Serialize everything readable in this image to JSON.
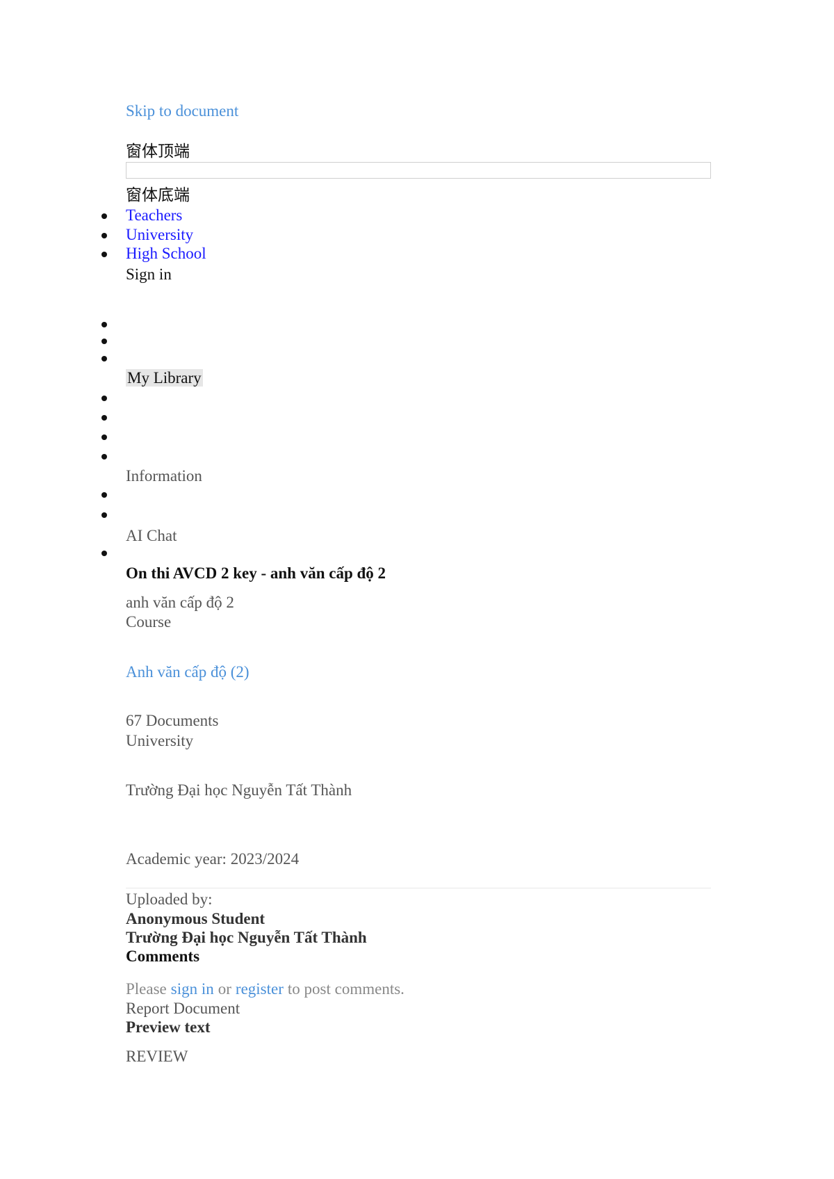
{
  "skip_link": "Skip to document",
  "form_top_label": "窗体顶端",
  "form_bottom_label": "窗体底端",
  "search": {
    "value": "",
    "placeholder": ""
  },
  "nav": {
    "items": [
      "Teachers",
      "University",
      "High School"
    ],
    "sign_in": "Sign in"
  },
  "library": {
    "label": "My Library"
  },
  "sections": {
    "information": "Information",
    "ai_chat": "AI Chat"
  },
  "document": {
    "title": "On thi AVCD 2 key - anh văn cấp độ 2",
    "subtitle": "anh văn cấp độ 2",
    "course_label": "Course",
    "course_link": "Anh văn cấp độ (2)",
    "documents_count": "67 Documents",
    "university_label": "University",
    "university_name": "Trường Đại học Nguyễn Tất Thành",
    "academic_year": "Academic year: 2023/2024"
  },
  "uploader": {
    "label": "Uploaded by:",
    "name": "Anonymous Student",
    "school": "Trường Đại học Nguyễn Tất Thành"
  },
  "comments": {
    "heading": "Comments",
    "prefix": "Please",
    "sign_in": "sign in",
    "or": "or",
    "register": "register",
    "suffix": "to post comments."
  },
  "report": "Report Document",
  "preview": {
    "heading": "Preview text",
    "text": "REVIEW"
  }
}
